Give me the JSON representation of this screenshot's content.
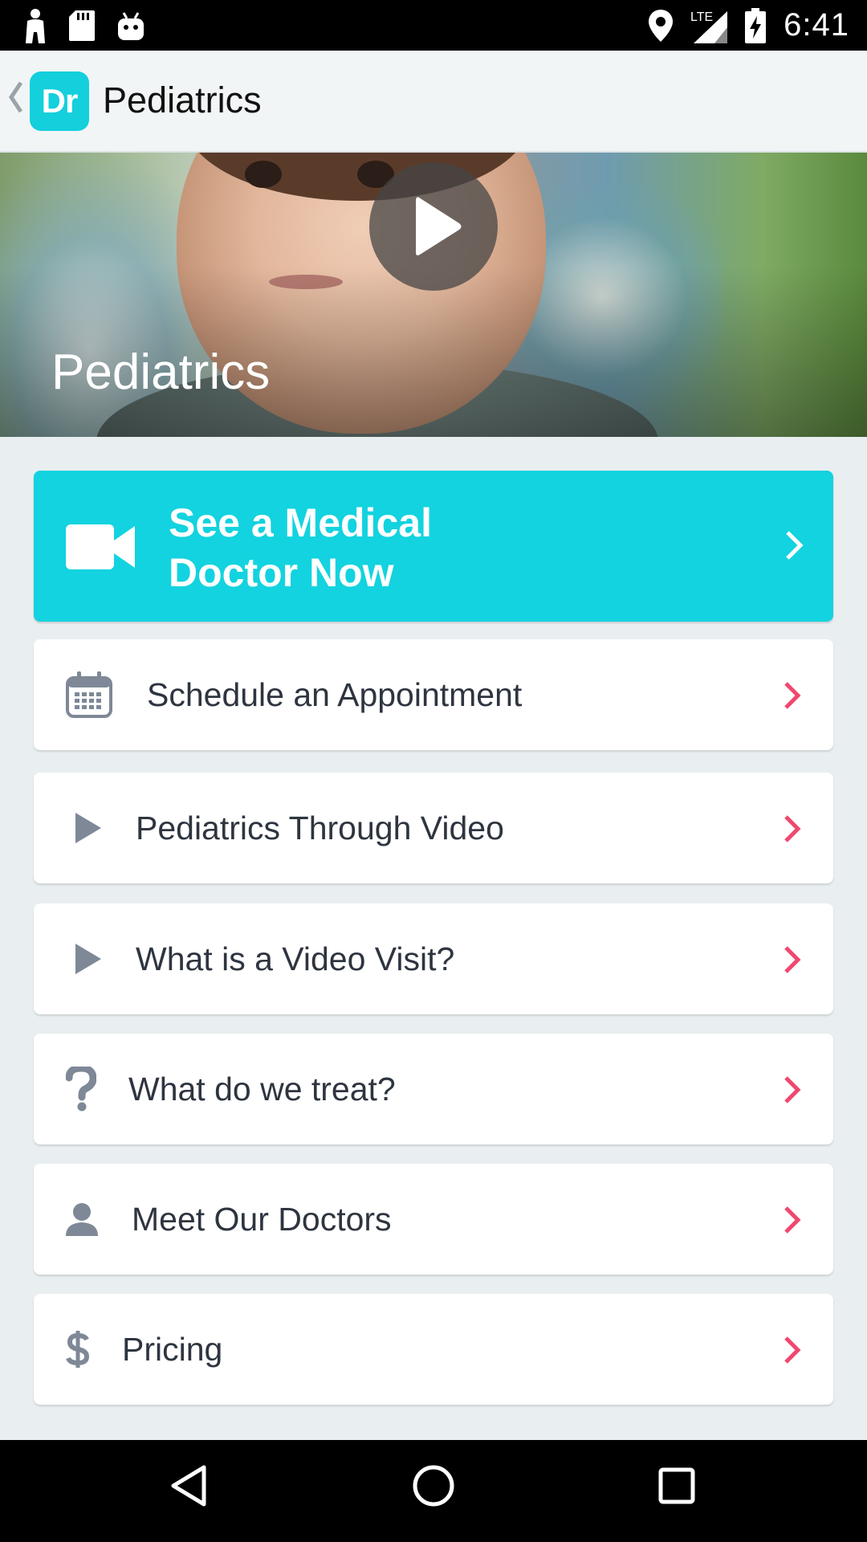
{
  "status_bar": {
    "time": "6:41",
    "network": "LTE",
    "icons": [
      "person-icon",
      "sd-card-icon",
      "android-icon",
      "location-icon",
      "signal-icon",
      "battery-charging-icon"
    ]
  },
  "app_bar": {
    "logo_text": "Dr",
    "title": "Pediatrics"
  },
  "hero": {
    "title": "Pediatrics",
    "play_icon": "play-icon"
  },
  "cta": {
    "label_line1": "See a Medical",
    "label_line2": "Doctor Now",
    "icon": "video-camera-icon",
    "background": "#12d3df"
  },
  "menu": {
    "chevron_color": "#f0486e",
    "items": [
      {
        "label": "Schedule an Appointment",
        "icon": "calendar-icon"
      },
      {
        "label": "Pediatrics Through Video",
        "icon": "play-icon"
      },
      {
        "label": "What is a Video Visit?",
        "icon": "play-icon"
      },
      {
        "label": "What do we treat?",
        "icon": "question-icon"
      },
      {
        "label": "Meet Our Doctors",
        "icon": "person-icon"
      },
      {
        "label": "Pricing",
        "icon": "dollar-icon"
      }
    ]
  },
  "nav_bar": {
    "buttons": [
      "back-icon",
      "home-icon",
      "recents-icon"
    ]
  }
}
